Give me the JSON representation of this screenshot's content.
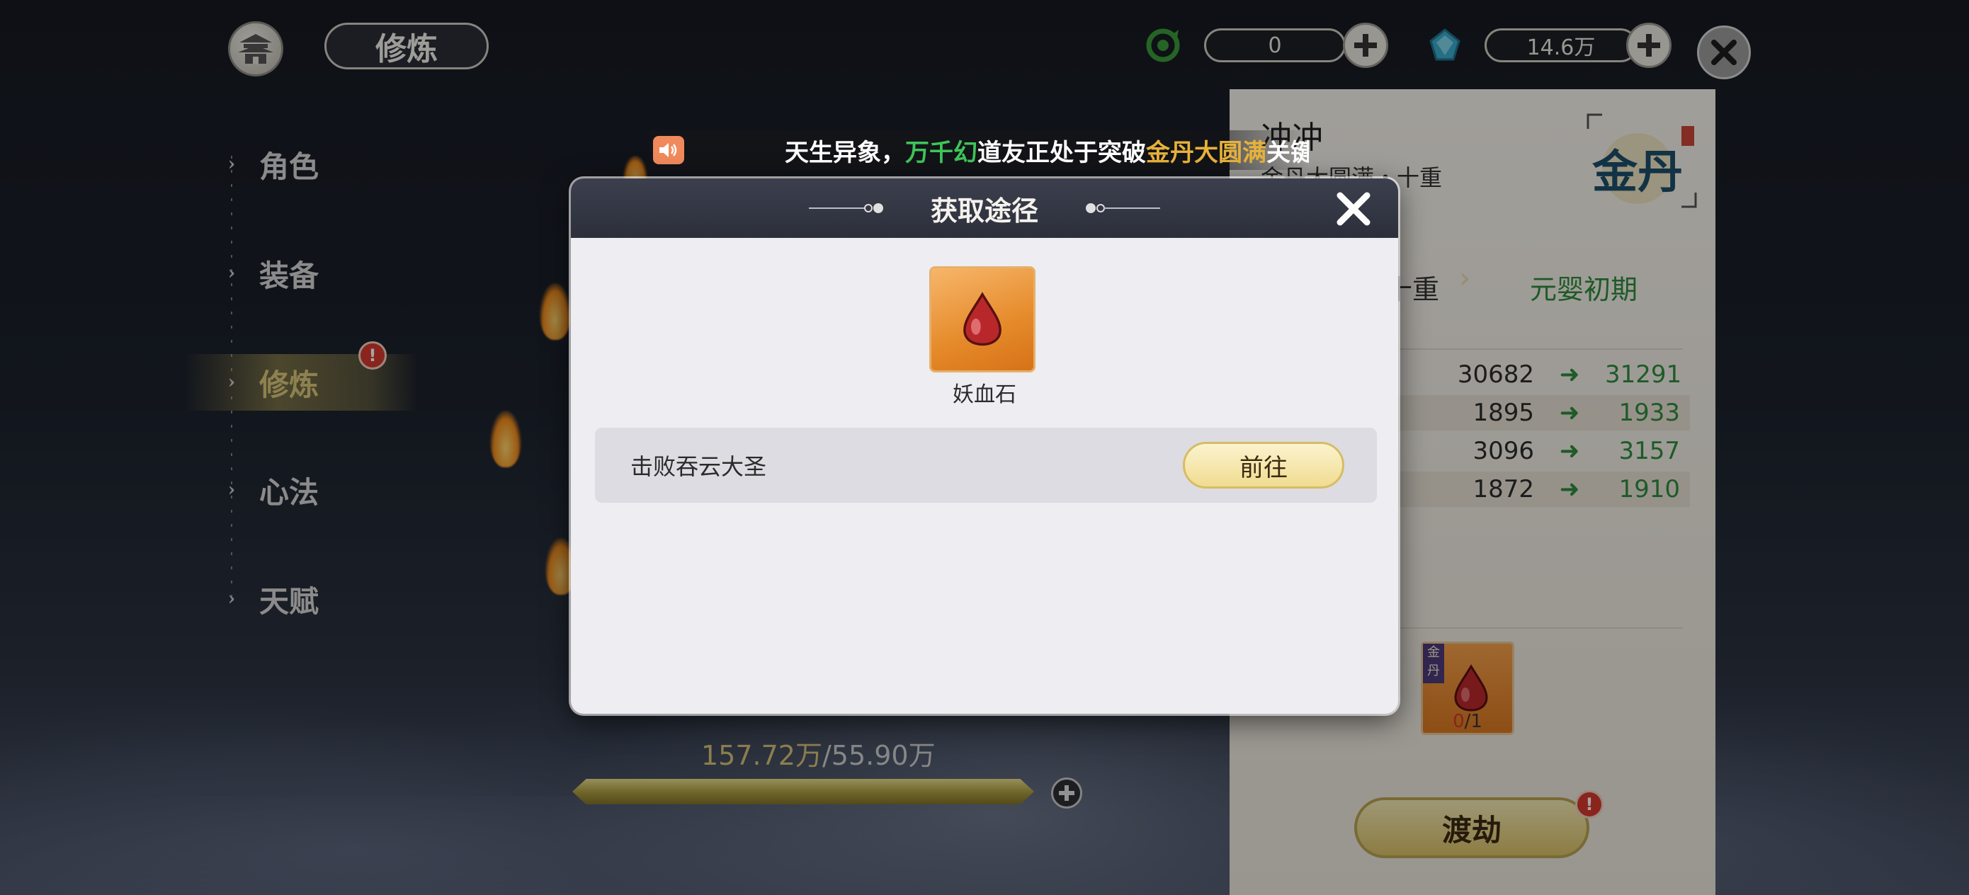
{
  "header": {
    "title": "修炼",
    "resource1": {
      "icon": "green-swirl-icon",
      "value": "0"
    },
    "resource2": {
      "icon": "blue-gem-icon",
      "value": "14.6万"
    }
  },
  "nav": {
    "items": [
      {
        "label": "角色"
      },
      {
        "label": "装备"
      },
      {
        "label": "修炼",
        "badge": "!"
      },
      {
        "label": "心法"
      },
      {
        "label": "天赋"
      }
    ]
  },
  "marquee": {
    "part1": "天生异象，",
    "name": "万千幻",
    "part2": "道友正处于突破",
    "realm": "金丹大圆满",
    "part3": "关键"
  },
  "progress": {
    "current": "157.72万",
    "separator": "/",
    "required": "55.90万"
  },
  "right_panel": {
    "name": "冲冲",
    "subtitle": "金丹大圆满・十重",
    "emblem_text": "金丹",
    "from_realm": "十重",
    "to_realm": "元婴初期",
    "stats": [
      {
        "from": "30682",
        "to": "31291"
      },
      {
        "from": "1895",
        "to": "1933"
      },
      {
        "from": "3096",
        "to": "3157"
      },
      {
        "from": "1872",
        "to": "1910"
      }
    ],
    "item_tag": "金丹",
    "item_have": "0",
    "item_need": "/1",
    "breakthrough_label": "渡劫",
    "breakthrough_badge": "!"
  },
  "modal": {
    "title": "获取途径",
    "item_name": "妖血石",
    "route_label": "击败吞云大圣",
    "go_label": "前往"
  },
  "colors": {
    "accent_gold": "#d9c067",
    "green": "#2e8d3e",
    "badge_red": "#d43a2f"
  }
}
